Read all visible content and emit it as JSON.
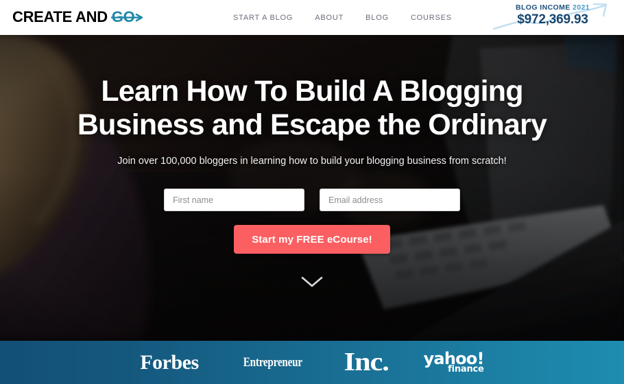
{
  "header": {
    "logo": {
      "part1": "CREATE AND",
      "part2": "GO",
      "icon": "arrow-right-strikethrough-icon"
    },
    "nav": [
      {
        "label": "START A BLOG",
        "name": "nav-start-a-blog"
      },
      {
        "label": "ABOUT",
        "name": "nav-about"
      },
      {
        "label": "BLOG",
        "name": "nav-blog"
      },
      {
        "label": "COURSES",
        "name": "nav-courses"
      }
    ],
    "income_widget": {
      "label": "BLOG INCOME",
      "year": "2021",
      "value": "$972,369.93",
      "icon": "rising-trend-arrow-icon",
      "label_color": "#1c4f7c",
      "year_color": "#3f9ccb",
      "value_color": "#17466f",
      "arrow_color": "#bcdcee"
    }
  },
  "hero": {
    "headline_line1": "Learn How To Build A Blogging",
    "headline_line2": "Business and Escape the Ordinary",
    "subheadline": "Join over 100,000 bloggers in learning how to build your blogging business from scratch!",
    "form": {
      "first_name_placeholder": "First name",
      "first_name_value": "",
      "email_placeholder": "Email address",
      "email_value": "",
      "cta_label": "Start my FREE eCourse!",
      "cta_color": "#fb5f62"
    },
    "scroll_icon": "chevron-down-icon"
  },
  "press_bar": {
    "gradient_from": "#134f77",
    "gradient_to": "#1d8db0",
    "logos": [
      {
        "name": "press-logo-forbes",
        "label": "Forbes"
      },
      {
        "name": "press-logo-entrepreneur",
        "label": "Entrepreneur"
      },
      {
        "name": "press-logo-inc",
        "label": "Inc."
      },
      {
        "name": "press-logo-yahoo-finance",
        "label_top": "yahoo!",
        "label_bottom": "finance"
      }
    ]
  }
}
